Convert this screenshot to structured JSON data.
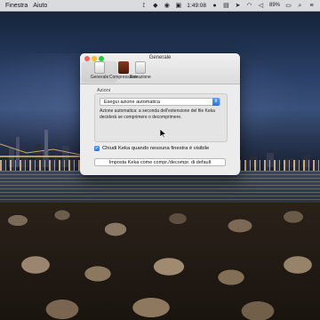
{
  "menubar": {
    "menus": [
      "Finestra",
      "Aiuto"
    ],
    "clock": "1:49:08",
    "battery_pct": "89%",
    "tray_icons": [
      "notification-icon",
      "dropbox-icon",
      "color-icon",
      "app-icon",
      "mic-icon",
      "lock-icon",
      "nav-icon",
      "wifi-icon",
      "volume-icon",
      "battery-icon",
      "spotlight-icon",
      "list-icon"
    ]
  },
  "window": {
    "title": "Generale",
    "toolbar": [
      {
        "label": "Generale",
        "icon": "document-icon",
        "selected": true
      },
      {
        "label": "Compressione",
        "icon": "archive-icon",
        "selected": false
      },
      {
        "label": "Estrazione",
        "icon": "extract-icon",
        "selected": false
      }
    ],
    "actions": {
      "group_label": "Azioni",
      "select_value": "Esegui azione automatica",
      "description": "Azione automatica: a seconda dell'estensione del file Keka deciderà se comprimere o decomprimere."
    },
    "checkbox": {
      "label": "Chiudi Keka quando nessuna finestra è visibile",
      "checked": true
    },
    "default_button": "Imposta Keka come compr./decompr. di default"
  },
  "colors": {
    "accent": "#2a73e0",
    "close": "#ff5f57",
    "minimize": "#febc2e",
    "zoom": "#28c840"
  }
}
